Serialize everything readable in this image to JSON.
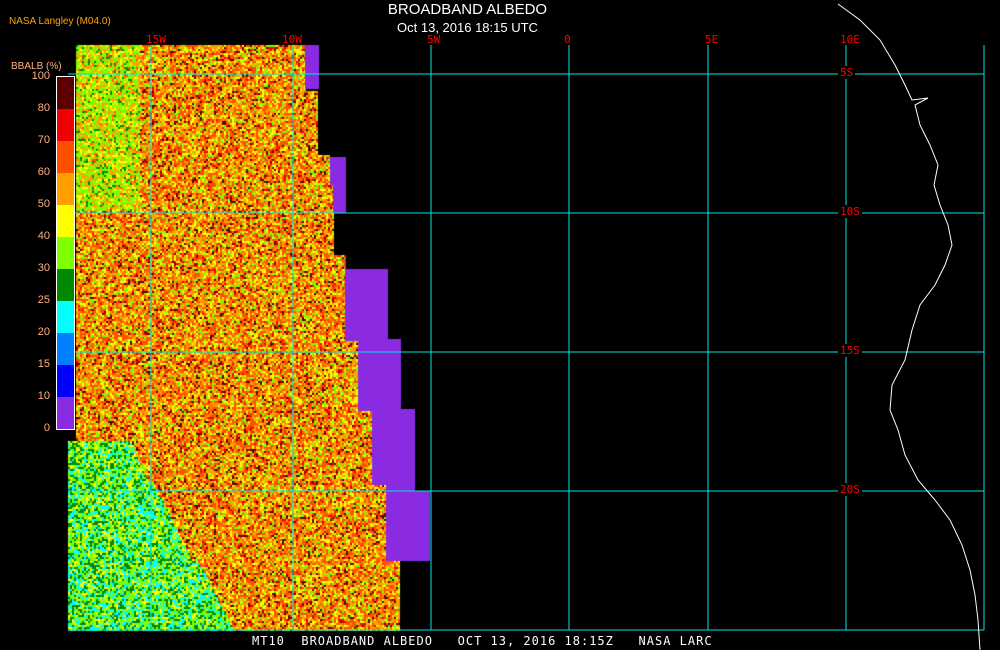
{
  "header": {
    "title": "BROADBAND ALBEDO",
    "datetime": "Oct 13, 2016 18:15 UTC",
    "source": "NASA Langley (M04.0)"
  },
  "map": {
    "lon_labels": [
      "15W",
      "10W",
      "5W",
      "0",
      "5E",
      "10E"
    ],
    "lat_labels": [
      "5S",
      "10S",
      "15S",
      "20S"
    ]
  },
  "legend": {
    "title": "BBALB (%)",
    "ticks": [
      "100",
      "80",
      "70",
      "60",
      "50",
      "40",
      "30",
      "25",
      "20",
      "15",
      "10",
      "0"
    ],
    "colors": [
      "#5c0000",
      "#f00000",
      "#ff5000",
      "#ffa000",
      "#ffff00",
      "#80ff00",
      "#008800",
      "#00ffff",
      "#0080ff",
      "#0000ff",
      "#8a2be2"
    ]
  },
  "footer": {
    "text": "MT10  BROADBAND ALBEDO   OCT 13, 2016 18:15Z   NASA LARC"
  }
}
